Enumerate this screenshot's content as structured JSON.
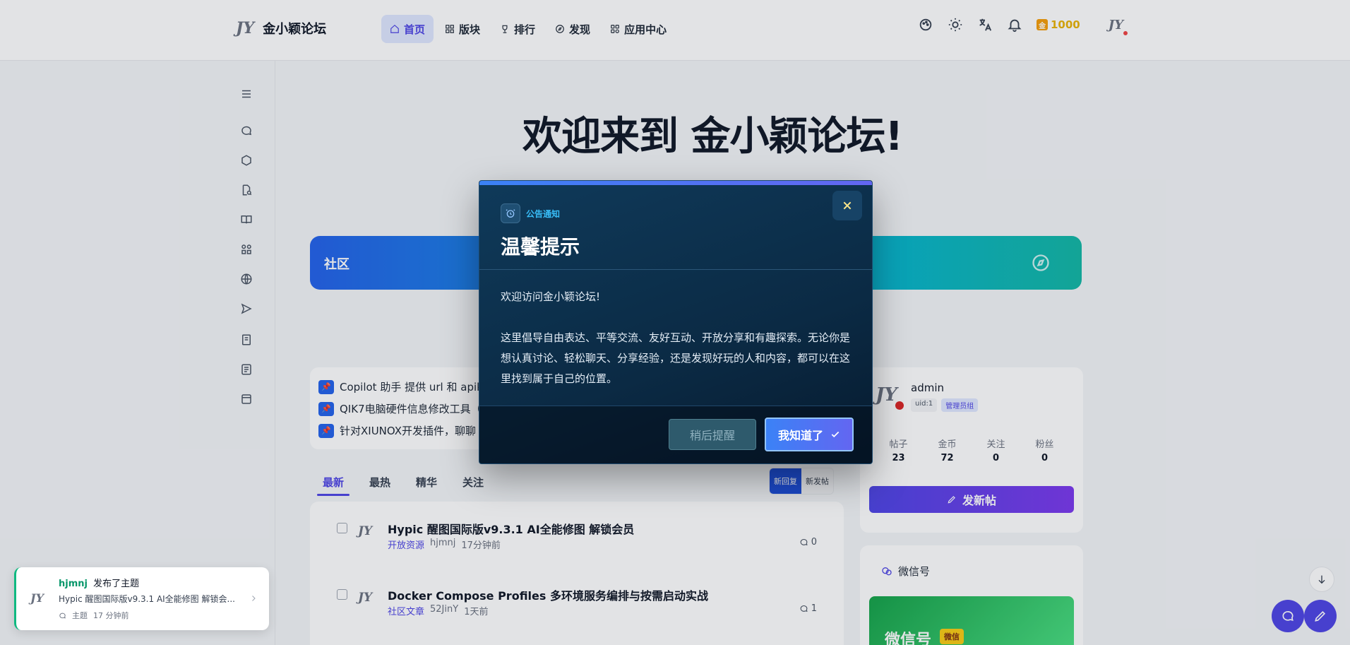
{
  "header": {
    "logo_mark": "JY",
    "site_name": "金小颖论坛",
    "nav": [
      {
        "label": "首页",
        "icon": "home-icon",
        "active": true
      },
      {
        "label": "版块",
        "icon": "grid-icon",
        "active": false
      },
      {
        "label": "排行",
        "icon": "trophy-icon",
        "active": false
      },
      {
        "label": "发现",
        "icon": "compass-icon",
        "active": false
      },
      {
        "label": "应用中心",
        "icon": "apps-icon",
        "active": false
      }
    ],
    "coins": "1000",
    "coin_badge": "金"
  },
  "hero": {
    "title": "欢迎来到 金小颖论坛!"
  },
  "banner": {
    "label": "社区"
  },
  "pinned": [
    "Copilot 助手 提供 url 和 apike",
    "QIK7电脑硬件信息修改工具（",
    "针对XIUNOX开发插件，聊聊"
  ],
  "tabs": [
    "最新",
    "最热",
    "精华",
    "关注"
  ],
  "sort": {
    "new_reply": "新回复",
    "new_post": "新发帖"
  },
  "posts": [
    {
      "title": "Hypic 醒图国际版v9.3.1 AI全能修图 解锁会员",
      "category": "开放资源",
      "author": "hjmnj",
      "time": "17分钟前",
      "replies": "0"
    },
    {
      "title": "Docker Compose Profiles 多环境服务编排与按需启动实战",
      "category": "社区文章",
      "author": "52JinY",
      "time": "1天前",
      "replies": "1"
    }
  ],
  "profile": {
    "name": "admin",
    "uid": "uid:1",
    "group": "管理员组",
    "stats": [
      {
        "label": "帖子",
        "value": "23"
      },
      {
        "label": "金币",
        "value": "72"
      },
      {
        "label": "关注",
        "value": "0"
      },
      {
        "label": "粉丝",
        "value": "0"
      }
    ],
    "post_button": "发新帖"
  },
  "wechat": {
    "title": "微信号",
    "card_title": "微信号",
    "card_badge": "微信"
  },
  "toast": {
    "user": "hjmnj",
    "action": "发布了主题",
    "text": "Hypic 醒图国际版v9.3.1 AI全能修图 解锁会...",
    "type": "主题",
    "time": "17 分钟前"
  },
  "modal": {
    "tag": "公告通知",
    "title": "温馨提示",
    "body_1": "欢迎访问金小颖论坛!",
    "body_2": "这里倡导自由表达、平等交流、友好互动、开放分享和有趣探索。无论你是想认真讨论、轻松聊天、分享经验，还是发现好玩的人和内容，都可以在这里找到属于自己的位置。",
    "later_button": "稍后提醒",
    "ok_button": "我知道了"
  },
  "colors": {
    "accent": "#4f46e5",
    "modal_bg": "#0b2a44",
    "banner_start": "#2563eb",
    "banner_end": "#14b8a6"
  }
}
